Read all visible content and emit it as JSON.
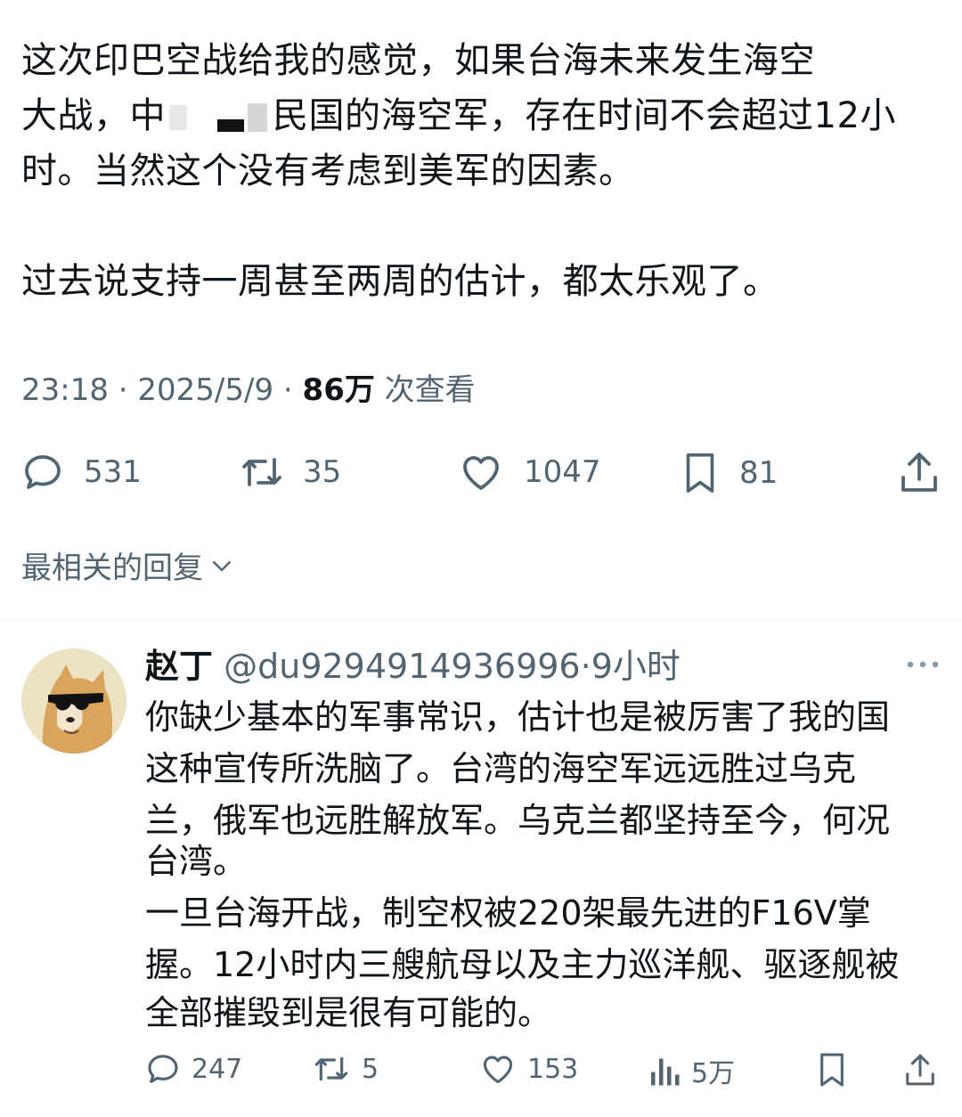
{
  "tweet": {
    "lines": [
      "这次印巴空战给我的感觉，如果台海未来发生海空",
      "大战，中",
      "民国的海空军，存在时间不会超过12小",
      "时。当然这个没有考虑到美军的因素。",
      "过去说支持一周甚至两周的估计，都太乐观了。"
    ],
    "time": "23:18 · 2025/5/9 · ",
    "views_count": "86万",
    "views_label": " 次查看"
  },
  "actions": {
    "reply_count": "531",
    "retweet_count": "35",
    "like_count": "1047",
    "bookmark_count": "81"
  },
  "sort_label": "最相关的回复",
  "reply": {
    "name": "赵丁",
    "handle": "@du9294914936996",
    "time": "·9小时",
    "lines": [
      "你缺少基本的军事常识，估计也是被厉害了我的国",
      "这种宣传所洗脑了。台湾的海空军远远胜过乌克",
      "兰，俄军也远胜解放军。乌克兰都坚持至今，何况",
      "台湾。",
      "一旦台海开战，制空权被220架最先进的F16V掌",
      "握。12小时内三艘航母以及主力巡洋舰、驱逐舰被",
      "全部摧毁到是很有可能的。"
    ],
    "reply_count": "247",
    "retweet_count": "5",
    "like_count": "153",
    "views_count": "5万"
  }
}
